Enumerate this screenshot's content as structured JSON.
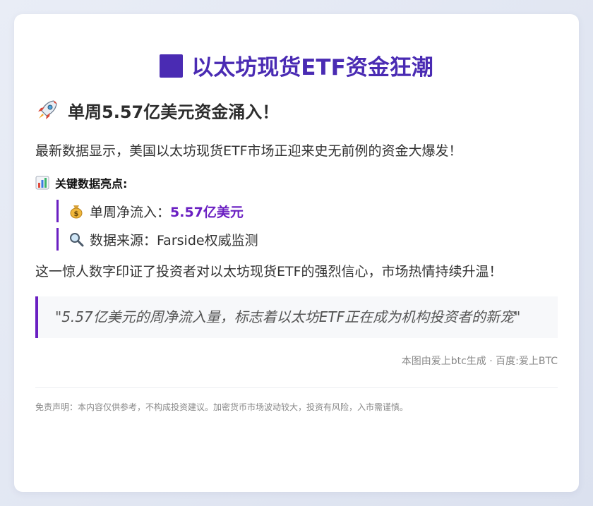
{
  "header": {
    "title": "以太坊现货ETF资金狂潮",
    "subtitle": "单周5.57亿美元资金涌入！"
  },
  "intro": "最新数据显示，美国以太坊现货ETF市场正迎来史无前例的资金大爆发！",
  "key_data": {
    "heading": "关键数据亮点:",
    "items": [
      {
        "icon": "money-bag-icon",
        "label": "单周净流入：",
        "value": "5.57亿美元"
      },
      {
        "icon": "magnifier-icon",
        "label": "数据来源：Farside权威监测",
        "value": ""
      }
    ]
  },
  "conclusion": "这一惊人数字印证了投资者对以太坊现货ETF的强烈信心，市场热情持续升温！",
  "quote": "\"5.57亿美元的周净流入量，标志着以太坊ETF正在成为机构投资者的新宠\"",
  "credit": "本图由爱上btc生成 · 百度:爱上BTC",
  "disclaimer": "免责声明：本内容仅供参考，不构成投资建议。加密货币市场波动较大，投资有风险，入市需谨慎。",
  "colors": {
    "accent": "#6a1fc2",
    "title": "#4a2bb3",
    "background": "#dbe1ef"
  }
}
